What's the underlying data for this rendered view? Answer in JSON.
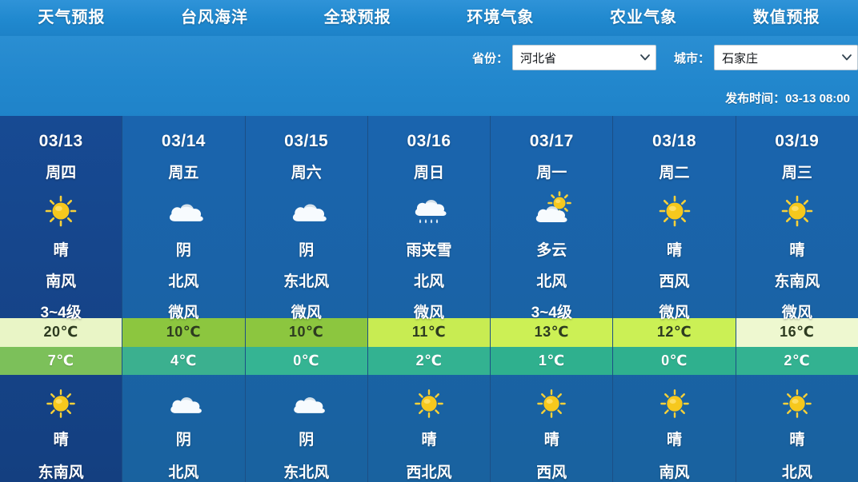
{
  "nav": {
    "items": [
      {
        "label": "天气预报",
        "name": "nav-weather-forecast"
      },
      {
        "label": "台风海洋",
        "name": "nav-typhoon-ocean"
      },
      {
        "label": "全球预报",
        "name": "nav-global-forecast"
      },
      {
        "label": "环境气象",
        "name": "nav-environment-meteorology"
      },
      {
        "label": "农业气象",
        "name": "nav-agriculture-meteorology"
      },
      {
        "label": "数值预报",
        "name": "nav-numerical-forecast"
      }
    ]
  },
  "selectors": {
    "province": {
      "label": "省份：",
      "value": "河北省"
    },
    "city": {
      "label": "城市：",
      "value": "石家庄"
    }
  },
  "publish": {
    "text": "发布时间：03-13 08:00"
  },
  "colors": {
    "nav_blue": "#2089cf",
    "panel_blue": "#19629f",
    "selected_blue": "#143f80",
    "sun_yellow": "#f5c518",
    "cloud_white": "#f4f8fb"
  },
  "forecast": {
    "days": [
      {
        "date": "03/13",
        "weekday": "周四",
        "selected": true,
        "day": {
          "icon": "sun-icon",
          "condition": "晴",
          "wind_dir": "南风",
          "wind_force": "3~4级"
        },
        "high": {
          "value": "20℃",
          "bg": "#e9f5c6"
        },
        "low": {
          "value": "7℃",
          "bg": "#7cc05a"
        },
        "night": {
          "icon": "sun-icon",
          "condition": "晴",
          "wind_dir": "东南风"
        }
      },
      {
        "date": "03/14",
        "weekday": "周五",
        "selected": false,
        "day": {
          "icon": "cloud-icon",
          "condition": "阴",
          "wind_dir": "北风",
          "wind_force": "微风"
        },
        "high": {
          "value": "10℃",
          "bg": "#8cc63f"
        },
        "low": {
          "value": "4℃",
          "bg": "#3bb08f"
        },
        "night": {
          "icon": "cloud-icon",
          "condition": "阴",
          "wind_dir": "北风"
        }
      },
      {
        "date": "03/15",
        "weekday": "周六",
        "selected": false,
        "day": {
          "icon": "cloud-icon",
          "condition": "阴",
          "wind_dir": "东北风",
          "wind_force": "微风"
        },
        "high": {
          "value": "10℃",
          "bg": "#8cc63f"
        },
        "low": {
          "value": "0℃",
          "bg": "#35b493"
        },
        "night": {
          "icon": "cloud-icon",
          "condition": "阴",
          "wind_dir": "东北风"
        }
      },
      {
        "date": "03/16",
        "weekday": "周日",
        "selected": false,
        "day": {
          "icon": "sleet-icon",
          "condition": "雨夹雪",
          "wind_dir": "北风",
          "wind_force": "微风"
        },
        "high": {
          "value": "11℃",
          "bg": "#c8ec52"
        },
        "low": {
          "value": "2℃",
          "bg": "#33b291"
        },
        "night": {
          "icon": "sun-icon",
          "condition": "晴",
          "wind_dir": "西北风"
        }
      },
      {
        "date": "03/17",
        "weekday": "周一",
        "selected": false,
        "day": {
          "icon": "partly-cloudy-icon",
          "condition": "多云",
          "wind_dir": "北风",
          "wind_force": "3~4级"
        },
        "high": {
          "value": "13℃",
          "bg": "#ccf055"
        },
        "low": {
          "value": "1℃",
          "bg": "#2fb08e"
        },
        "night": {
          "icon": "sun-icon",
          "condition": "晴",
          "wind_dir": "西风"
        }
      },
      {
        "date": "03/18",
        "weekday": "周二",
        "selected": false,
        "day": {
          "icon": "sun-icon",
          "condition": "晴",
          "wind_dir": "西风",
          "wind_force": "微风"
        },
        "high": {
          "value": "12℃",
          "bg": "#cbf055"
        },
        "low": {
          "value": "0℃",
          "bg": "#2fb08e"
        },
        "night": {
          "icon": "sun-icon",
          "condition": "晴",
          "wind_dir": "南风"
        }
      },
      {
        "date": "03/19",
        "weekday": "周三",
        "selected": false,
        "day": {
          "icon": "sun-icon",
          "condition": "晴",
          "wind_dir": "东南风",
          "wind_force": "微风"
        },
        "high": {
          "value": "16℃",
          "bg": "#eef8d0"
        },
        "low": {
          "value": "2℃",
          "bg": "#33b291"
        },
        "night": {
          "icon": "sun-icon",
          "condition": "晴",
          "wind_dir": "北风"
        }
      }
    ]
  }
}
